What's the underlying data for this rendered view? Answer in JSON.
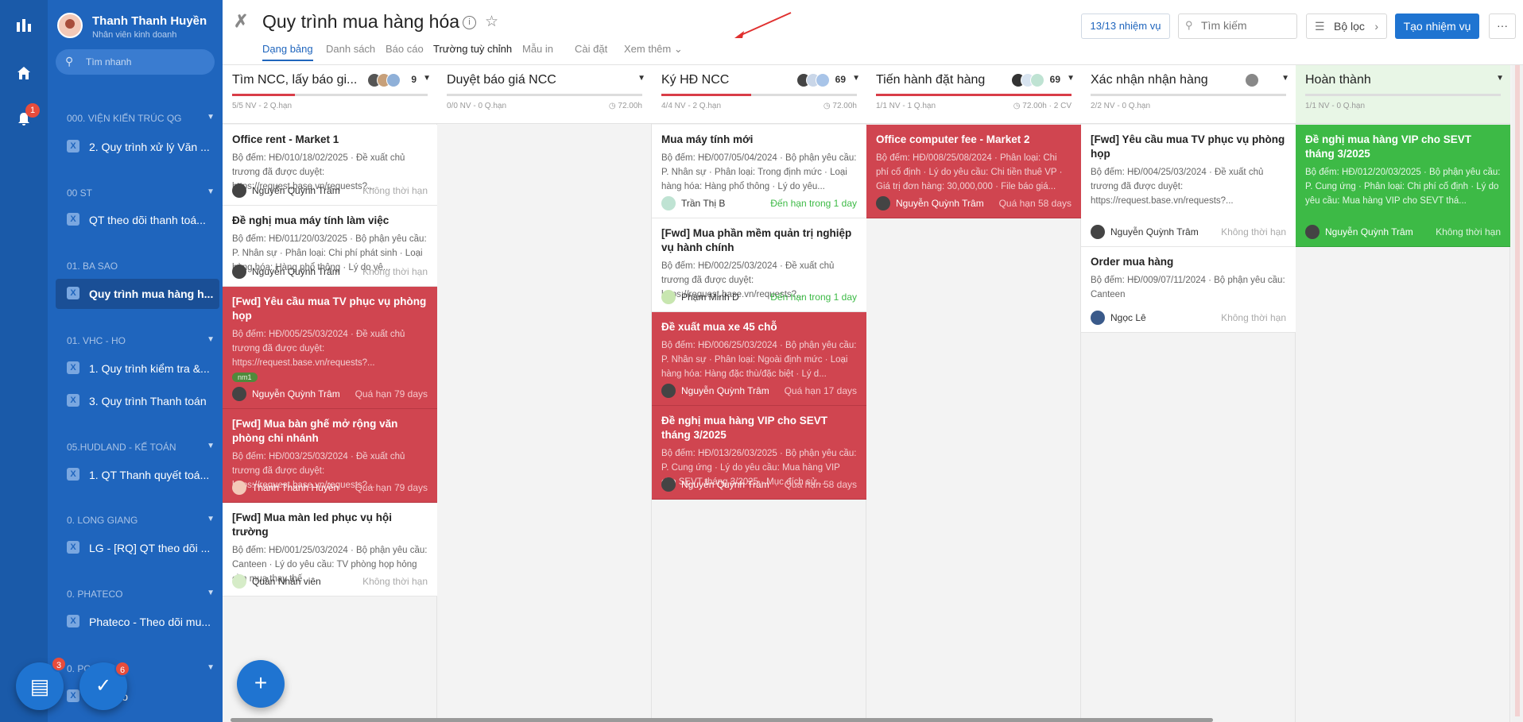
{
  "rail": {
    "notif_count": "1"
  },
  "user": {
    "name": "Thanh Thanh Huyền",
    "role": "Nhân viên kinh doanh"
  },
  "quick_search": {
    "placeholder": "Tìm nhanh"
  },
  "sidebar": {
    "groups": [
      {
        "title": "000. VIỆN KIẾN TRÚC QG",
        "items": [
          "2. Quy trình xử lý Văn ..."
        ]
      },
      {
        "title": "00 ST",
        "items": [
          "QT theo dõi thanh toá..."
        ]
      },
      {
        "title": "01. BA SAO",
        "items": [
          "Quy trình mua hàng h..."
        ]
      },
      {
        "title": "01. VHC - HO",
        "items": [
          "1. Quy trình kiểm tra &...",
          "3. Quy trình Thanh toán"
        ]
      },
      {
        "title": "05.HUDLAND - KẾ TOÁN",
        "items": [
          "1. QT Thanh quyết toá..."
        ]
      },
      {
        "title": "0. LONG GIANG",
        "items": [
          "LG - [RQ] QT theo dõi ..."
        ]
      },
      {
        "title": "0. PHATECO",
        "items": [
          "Phateco - Theo dõi mu..."
        ]
      },
      {
        "title": "0. PO",
        "items": [
          "Đào tạo"
        ]
      }
    ]
  },
  "fabs": {
    "chat_badge": "3",
    "task_badge": "6",
    "add_icon": "+"
  },
  "header": {
    "title": "Quy trình mua hàng hóa",
    "tabs": [
      "Dạng bảng",
      "Danh sách",
      "Báo cáo",
      "Trường tuỳ chỉnh",
      "Mẫu in",
      "Cài đặt",
      "Xem thêm"
    ],
    "task_count": "13/13 nhiệm vụ",
    "search_placeholder": "Tìm kiếm",
    "filter_label": "Bộ lọc",
    "new_task_label": "Tạo nhiệm vụ",
    "more_label": "···"
  },
  "columns": [
    {
      "title": "Tìm NCC, lấy báo gi...",
      "count": "9",
      "progress": 0.32,
      "meta": "5/5 NV - 2 Q.hạn",
      "meta2": "",
      "cards": [
        {
          "title": "Office rent - Market 1",
          "desc": "Bộ đếm: HĐ/010/18/02/2025 · Đề xuất chủ trương đã được duyệt: https://request.base.vn/requests?...",
          "assignee": "Nguyễn Quỳnh Trâm",
          "status": "Không thời hạn",
          "style": "white",
          "tag": ""
        },
        {
          "title": "Đề nghị mua máy tính làm việc",
          "desc": "Bộ đếm: HĐ/011/20/03/2025 · Bộ phận yêu cầu: P. Nhân sự · Phân loại: Chi phí phát sinh · Loại hàng hóa: Hàng phổ thông · Lý do yê...",
          "assignee": "Nguyễn Quỳnh Trâm",
          "status": "Không thời hạn",
          "style": "white",
          "tag": ""
        },
        {
          "title": "[Fwd] Yêu cầu mua TV phục vụ phòng họp",
          "desc": "Bộ đếm: HĐ/005/25/03/2024 · Đề xuất chủ trương đã được duyệt: https://request.base.vn/requests?...",
          "assignee": "Nguyễn Quỳnh Trâm",
          "status": "Quá hạn 79 days",
          "style": "red",
          "tag": "nm1"
        },
        {
          "title": "[Fwd] Mua bàn ghế mở rộng văn phòng chi nhánh",
          "desc": "Bộ đếm: HĐ/003/25/03/2024 · Đề xuất chủ trương đã được duyệt: https://request.base.vn/requests?...",
          "assignee": "Thanh Thanh Huyền",
          "status": "Quá hạn 79 days",
          "style": "red",
          "tag": ""
        },
        {
          "title": "[Fwd] Mua màn led phục vụ hội trường",
          "desc": "Bộ đếm: HĐ/001/25/03/2024 · Bộ phận yêu cầu: Canteen · Lý do yêu cầu: TV phòng họp hỏng cần mua thay thế",
          "assignee": "Quản Nhân viên",
          "status": "Không thời hạn",
          "style": "white",
          "tag": ""
        }
      ]
    },
    {
      "title": "Duyệt báo giá NCC",
      "count": "",
      "progress": 0,
      "meta": "0/0 NV - 0 Q.hạn",
      "meta2": "72.00h",
      "cards": []
    },
    {
      "title": "Ký HĐ NCC",
      "count": "69",
      "progress": 0.46,
      "meta": "4/4 NV - 2 Q.hạn",
      "meta2": "72.00h",
      "cards": [
        {
          "title": "Mua máy tính mới",
          "desc": "Bộ đếm: HĐ/007/05/04/2024 · Bộ phận yêu cầu: P. Nhân sự · Phân loại: Trong định mức · Loại hàng hóa: Hàng phổ thông · Lý do yêu...",
          "assignee": "Trần Thị B",
          "status": "Đến hạn trong 1 day",
          "style": "white",
          "tag": ""
        },
        {
          "title": "[Fwd] Mua phần mềm quản trị nghiệp vụ hành chính",
          "desc": "Bộ đếm: HĐ/002/25/03/2024 · Đề xuất chủ trương đã được duyệt: https://request.base.vn/requests?...",
          "assignee": "Phạm Minh D",
          "status": "Đến hạn trong 1 day",
          "style": "white",
          "tag": ""
        },
        {
          "title": "Đề xuất mua xe 45 chỗ",
          "desc": "Bộ đếm: HĐ/006/25/03/2024 · Bộ phận yêu cầu: P. Nhân sự · Phân loại: Ngoài định mức · Loại hàng hóa: Hàng đặc thù/đặc biệt · Lý d...",
          "assignee": "Nguyễn Quỳnh Trâm",
          "status": "Quá hạn 17 days",
          "style": "red",
          "tag": ""
        },
        {
          "title": "Đề nghị mua hàng VIP cho SEVT tháng 3/2025",
          "desc": "Bộ đếm: HĐ/013/26/03/2025 · Bộ phận yêu cầu: P. Cung ứng · Lý do yêu cầu: Mua hàng VIP cho SEVT tháng 3/2025 · Mục đích sử...",
          "assignee": "Nguyễn Quỳnh Trâm",
          "status": "Quá hạn 58 days",
          "style": "red",
          "tag": ""
        }
      ]
    },
    {
      "title": "Tiến hành đặt hàng",
      "count": "69",
      "progress": 1.0,
      "meta": "1/1 NV - 1 Q.hạn",
      "meta2": "72.00h · 2 CV",
      "cards": [
        {
          "title": "Office computer fee - Market 2",
          "desc": "Bộ đếm: HĐ/008/25/08/2024 · Phân loại: Chi phí cố định · Lý do yêu cầu: Chi tiền thuê VP · Giá trị đơn hàng: 30,000,000 · File báo giá...",
          "assignee": "Nguyễn Quỳnh Trâm",
          "status": "Quá hạn 58 days",
          "style": "red",
          "tag": ""
        }
      ]
    },
    {
      "title": "Xác nhận nhận hàng",
      "count": "",
      "progress": 0,
      "meta": "2/2 NV - 0 Q.hạn",
      "meta2": "",
      "cards": [
        {
          "title": "[Fwd] Yêu cầu mua TV phục vụ phòng họp",
          "desc": "Bộ đếm: HĐ/004/25/03/2024 · Đề xuất chủ trương đã được duyệt: https://request.base.vn/requests?...",
          "assignee": "Nguyễn Quỳnh Trâm",
          "status": "Không thời hạn",
          "style": "white",
          "tag": ""
        },
        {
          "title": "Order mua hàng",
          "desc": "Bộ đếm: HĐ/009/07/11/2024 · Bộ phận yêu cầu: Canteen",
          "assignee": "Ngọc Lê",
          "status": "Không thời hạn",
          "style": "white",
          "tag": ""
        }
      ]
    },
    {
      "title": "Hoàn thành",
      "count": "",
      "progress": 0,
      "meta": "1/1 NV - 0 Q.hạn",
      "meta2": "",
      "cards": [
        {
          "title": "Đề nghị mua hàng VIP cho SEVT tháng 3/2025",
          "desc": "Bộ đếm: HĐ/012/20/03/2025 · Bộ phận yêu cầu: P. Cung ứng · Phân loại: Chi phí cố định · Lý do yêu cầu: Mua hàng VIP cho SEVT thá...",
          "assignee": "Nguyễn Quỳnh Trâm",
          "status": "Không thời hạn",
          "style": "green",
          "tag": ""
        }
      ]
    }
  ],
  "colors": {
    "sidebar": "#1f65bd",
    "rail": "#1a5aa9",
    "accent": "#1f74d1",
    "overdue": "#d04550",
    "done": "#3dba46"
  }
}
